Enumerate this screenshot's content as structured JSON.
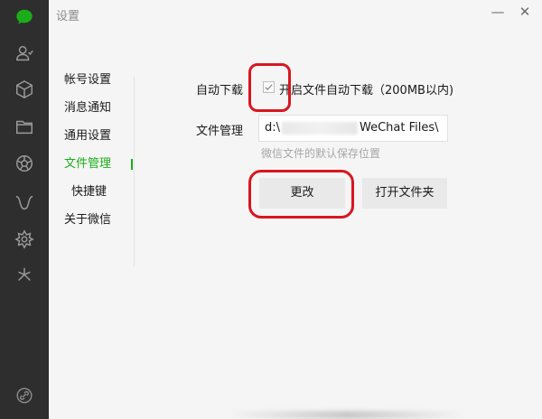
{
  "window": {
    "title": "设置",
    "minimize_glyph": "—",
    "close_glyph": "✕"
  },
  "rail_icons": [
    "chat-icon",
    "contacts-icon",
    "favorites-icon",
    "files-icon",
    "moments-icon",
    "mini-programs-icon",
    "channels-icon",
    "sparkle-icon",
    "more-icon"
  ],
  "nav": {
    "items": [
      {
        "label": "帐号设置"
      },
      {
        "label": "消息通知"
      },
      {
        "label": "通用设置"
      },
      {
        "label": "文件管理",
        "active": true
      },
      {
        "label": "快捷键"
      },
      {
        "label": "关于微信"
      }
    ]
  },
  "content": {
    "auto_download_label": "自动下载",
    "auto_download_checkbox": {
      "label": "开启文件自动下载（200MB以内)",
      "checked": true
    },
    "file_manage_label": "文件管理",
    "path": {
      "prefix": "d:\\",
      "suffix": "WeChat Files\\"
    },
    "hint": "微信文件的默认保存位置",
    "change_button": "更改",
    "open_folder_button": "打开文件夹"
  },
  "colors": {
    "rail_bg": "#2e2e2e",
    "accent": "#1aad19",
    "annotation": "#d9161f"
  }
}
